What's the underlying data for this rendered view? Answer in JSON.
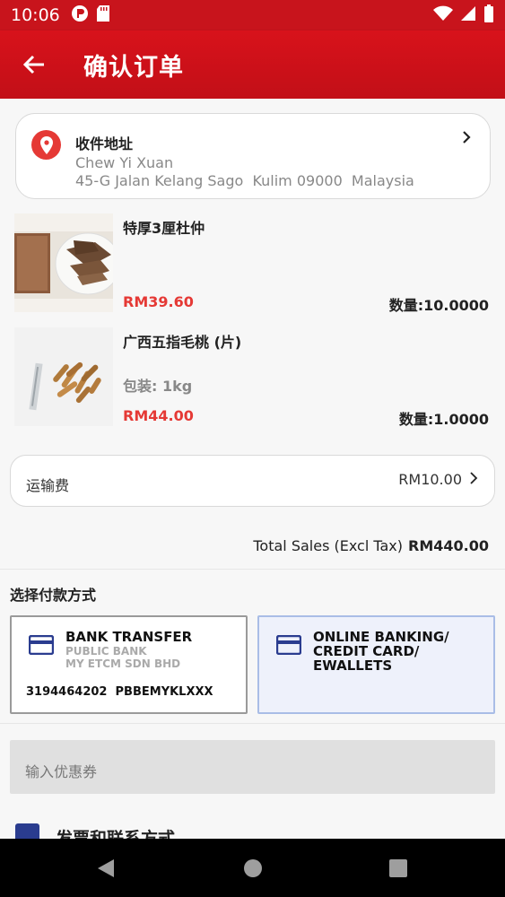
{
  "status_bar": {
    "time": "10:06",
    "icons": [
      "app-notification-icon",
      "sd-card-icon",
      "wifi-icon",
      "signal-icon",
      "battery-icon"
    ]
  },
  "app_bar": {
    "title": "确认订单",
    "back_icon": "arrow-left-icon"
  },
  "address": {
    "title": "收件地址",
    "name": "Chew Yi Xuan",
    "line": "45-G Jalan Kelang Sago  Kulim 09000  Malaysia",
    "icon": "location-pin-icon"
  },
  "products": [
    {
      "name": "特厚3厘杜仲",
      "package": "",
      "price": "RM39.60",
      "quantity": "数量:10.0000",
      "thumb_label": "杜仲"
    },
    {
      "name": "广西五指毛桃 (片)",
      "package": "包装: 1kg",
      "price": "RM44.00",
      "quantity": "数量:1.0000",
      "thumb_label": ""
    }
  ],
  "shipping": {
    "label": "运输费",
    "fee": "RM10.00"
  },
  "total": {
    "label": "Total Sales (Excl Tax)",
    "amount": "RM440.00"
  },
  "payment": {
    "section_title": "选择付款方式",
    "bank_transfer": {
      "title": "BANK TRANSFER",
      "bank": "PUBLIC BANK",
      "account_name": "MY ETCM SDN BHD",
      "account_number": "3194464202",
      "swift": "PBBEMYKLXXX"
    },
    "online": {
      "line1": "ONLINE BANKING/",
      "line2": "CREDIT CARD/",
      "line3": "EWALLETS"
    }
  },
  "coupon": {
    "placeholder": "输入优惠券"
  },
  "invoice": {
    "label": "发票和联系方式"
  },
  "colors": {
    "brand_red": "#c8141c",
    "price_red": "#e53935",
    "card_icon_blue": "#2a3c8f",
    "online_card_bg": "#eef1fb"
  }
}
